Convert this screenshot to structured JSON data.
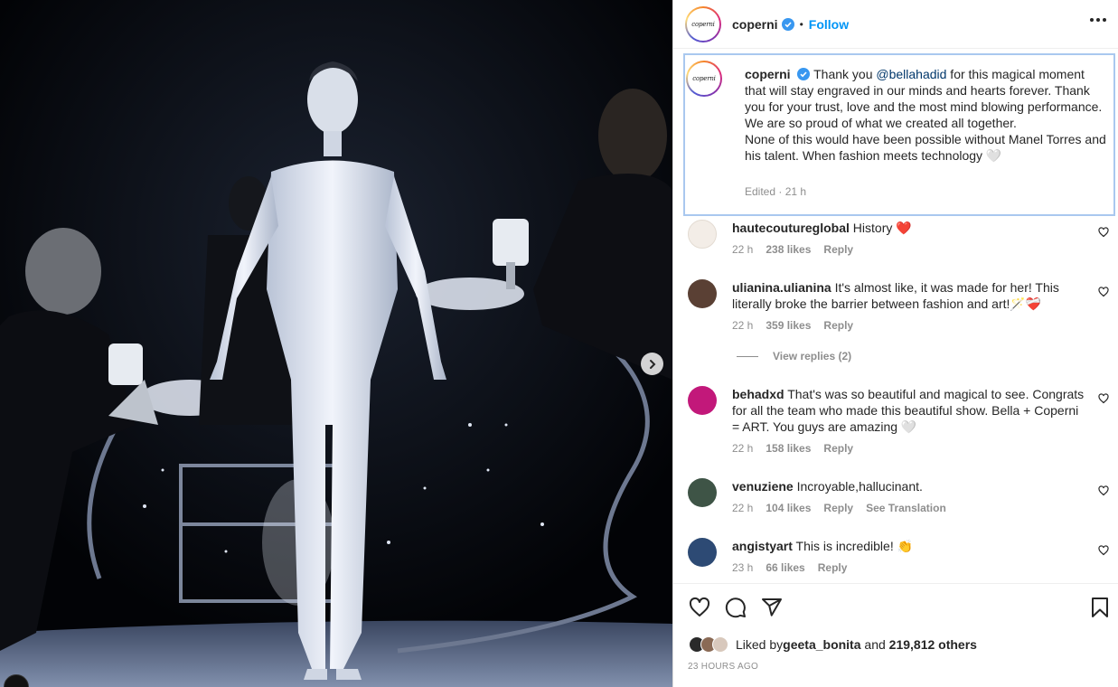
{
  "header": {
    "avatar_text": "coperni",
    "username": "coperni",
    "separator": "•",
    "follow_label": "Follow"
  },
  "caption": {
    "username": "coperni",
    "text_before_mention": " Thank you ",
    "mention": "@bellahadid",
    "text_after_mention": " for this magical moment that will stay engraved in our minds and hearts forever. Thank you for your trust, love and the most mind blowing performance. We are so proud of what we created all together.",
    "text_line2": "None of this would have been possible without Manel Torres and his talent. When fashion meets technology 🤍",
    "meta": "Edited · 21 h"
  },
  "comments": [
    {
      "username": "hautecoutureglobal",
      "text": " History ❤️",
      "time": "22 h",
      "likes": "238 likes",
      "reply": "Reply",
      "avatar_color": "#f3ede7"
    },
    {
      "username": "ulianina.ulianina",
      "text": " It's almost like, it was made for her! This literally broke the barrier between fashion and art!🪄❤️‍🩹",
      "time": "22 h",
      "likes": "359 likes",
      "reply": "Reply",
      "avatar_color": "#5a4034"
    },
    {
      "username": "behadxd",
      "text": " That's was so beautiful and magical to see. Congrats for all the team who made this beautiful show. Bella + Coperni = ART. You guys are amazing 🤍",
      "time": "22 h",
      "likes": "158 likes",
      "reply": "Reply",
      "avatar_color": "#c2187a"
    },
    {
      "username": "venuziene",
      "text": " Incroyable,hallucinant.",
      "time": "22 h",
      "likes": "104 likes",
      "reply": "Reply",
      "translate": "See Translation",
      "avatar_color": "#3e5446"
    },
    {
      "username": "angistyart",
      "text": " This is incredible! 👏",
      "time": "23 h",
      "likes": "66 likes",
      "reply": "Reply",
      "avatar_color": "#2d4a74"
    }
  ],
  "view_replies": "View replies (2)",
  "likes": {
    "prefix": "Liked by ",
    "user": "geeta_bonita",
    "middle": " and ",
    "others": "219,812 others"
  },
  "time_ago": "23 HOURS AGO",
  "icons": {
    "heart": "heart-icon",
    "comment": "comment-icon",
    "share": "share-icon",
    "save": "bookmark-icon",
    "more": "more-options-icon",
    "next": "chevron-right-icon",
    "verified": "verified-badge-icon"
  },
  "colors": {
    "accent": "#0095f6",
    "verified": "#3897f0",
    "mention": "#00376b",
    "muted": "#8e8e8e",
    "caption_outline": "#a9c8ef"
  }
}
